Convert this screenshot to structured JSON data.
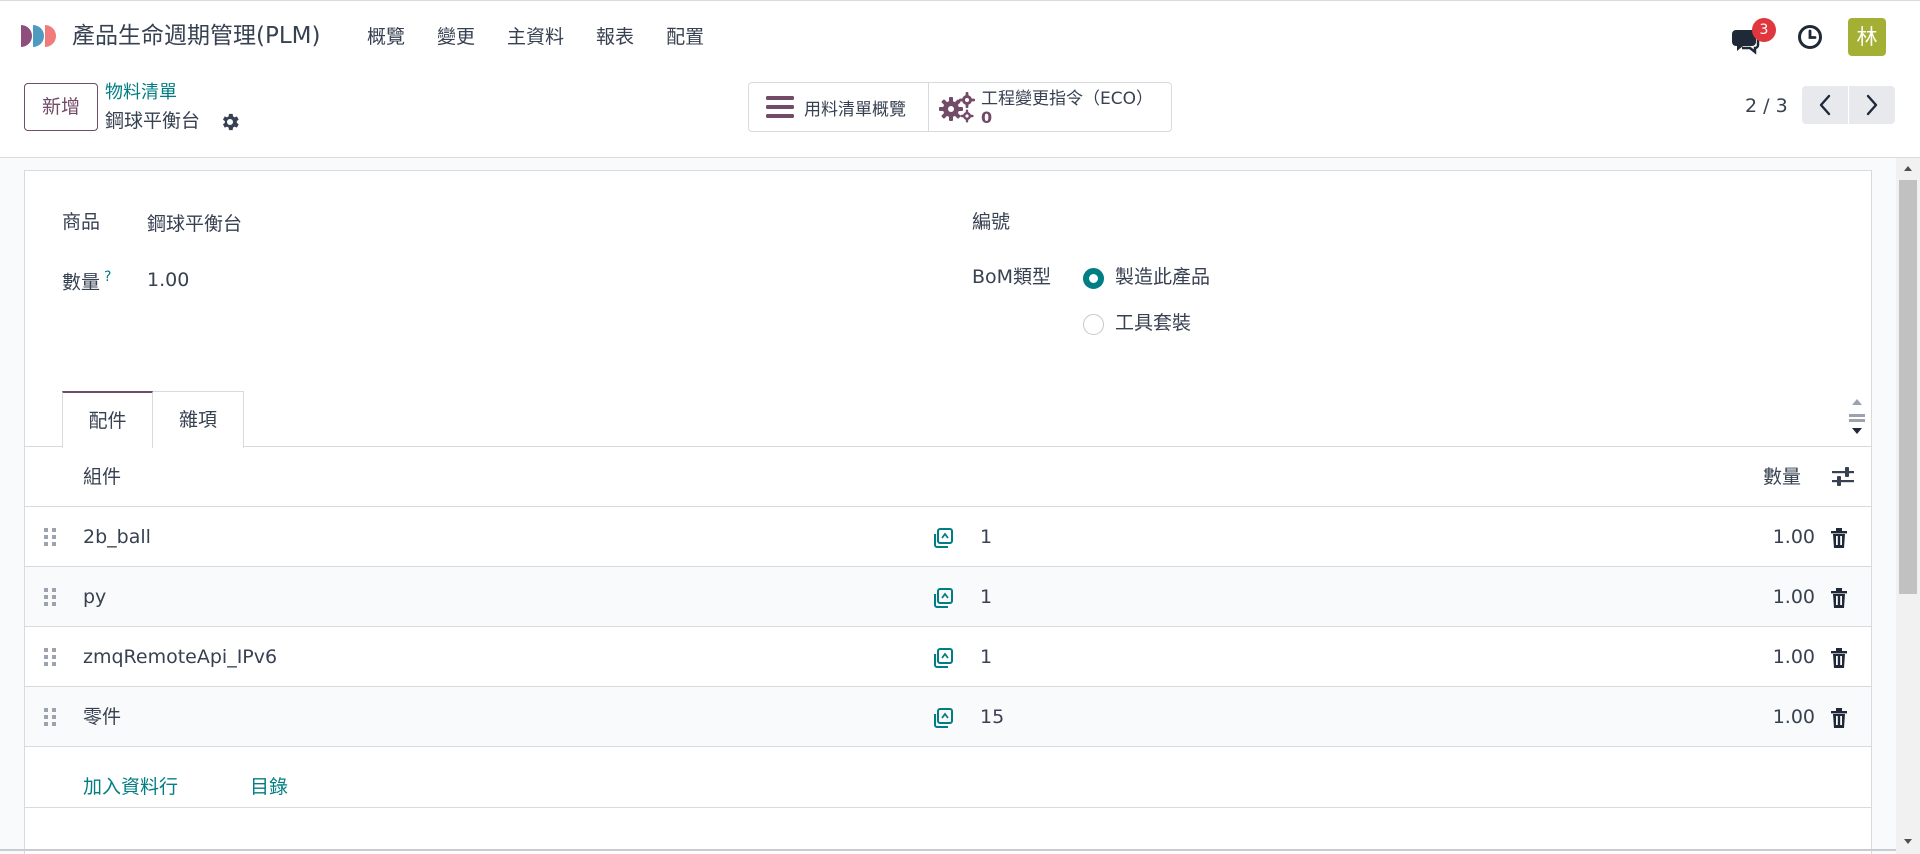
{
  "app": {
    "title": "產品生命週期管理(PLM)",
    "menu": [
      "概覽",
      "變更",
      "主資料",
      "報表",
      "配置"
    ],
    "notification_count": "3",
    "avatar_letter": "林"
  },
  "control_panel": {
    "new_button": "新增",
    "breadcrumb": "物料清單",
    "record_name": "鋼球平衡台",
    "smart_buttons": {
      "overview_label": "用料清單概覽",
      "eco_label": "工程變更指令（ECO）",
      "eco_count": "0"
    },
    "pager": {
      "value": "2 / 3"
    }
  },
  "form": {
    "product_label": "商品",
    "product_value": "鋼球平衡台",
    "quantity_label": "數量",
    "quantity_help": "?",
    "quantity_value": "1.00",
    "reference_label": "編號",
    "bom_type_label": "BoM類型",
    "bom_type_options": [
      "製造此產品",
      "工具套裝"
    ],
    "bom_type_selected": "製造此產品"
  },
  "tabs": [
    "配件",
    "雜項"
  ],
  "table": {
    "columns": {
      "component": "組件",
      "quantity": "數量"
    },
    "rows": [
      {
        "name": "2b_ball",
        "count": "1",
        "qty": "1.00"
      },
      {
        "name": "py",
        "count": "1",
        "qty": "1.00"
      },
      {
        "name": "zmqRemoteApi_IPv6",
        "count": "1",
        "qty": "1.00"
      },
      {
        "name": "零件",
        "count": "15",
        "qty": "1.00"
      }
    ],
    "add_line": "加入資料行",
    "catalog": "目錄"
  },
  "colors": {
    "brand": "#714b67",
    "accent": "#017e84",
    "badge": "#e0373e",
    "avatar": "#a4b034"
  }
}
